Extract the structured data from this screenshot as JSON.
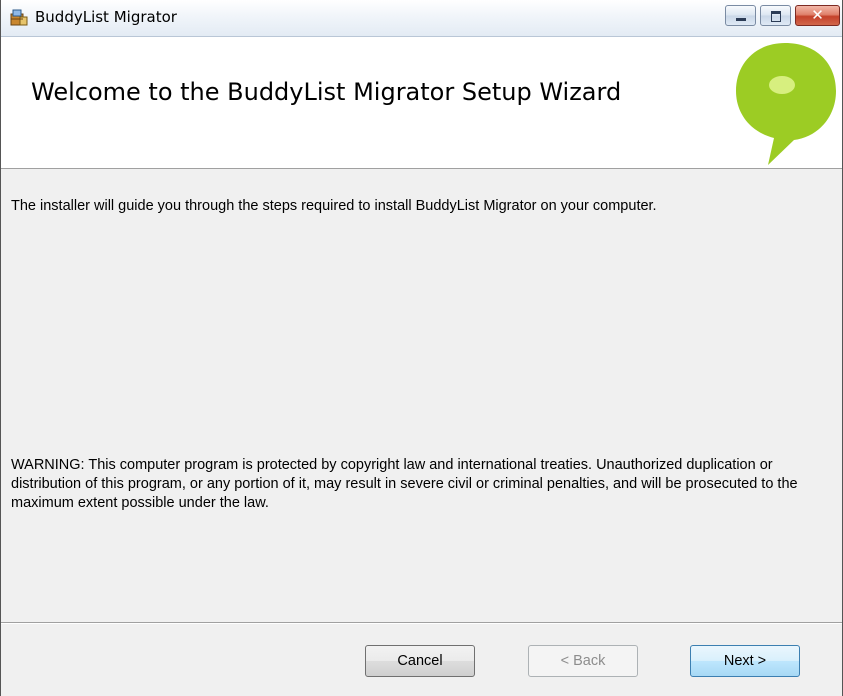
{
  "window": {
    "title": "BuddyList Migrator",
    "controls": {
      "minimize_icon": "minimize-icon",
      "maximize_icon": "maximize-icon",
      "close_icon": "close-icon",
      "close_glyph": "✕"
    }
  },
  "banner": {
    "heading": "Welcome to the BuddyList Migrator Setup Wizard",
    "logo_icon": "speech-bubble-logo",
    "logo_color": "#9ccc24"
  },
  "content": {
    "intro": "The installer will guide you through the steps required to install BuddyList Migrator on your computer.",
    "warning": "WARNING: This computer program is protected by copyright law and international treaties. Unauthorized duplication or distribution of this program, or any portion of it, may result in severe civil or criminal penalties, and will be prosecuted to the maximum extent possible under the law."
  },
  "buttons": {
    "cancel": "Cancel",
    "back": "< Back",
    "next": "Next >"
  }
}
